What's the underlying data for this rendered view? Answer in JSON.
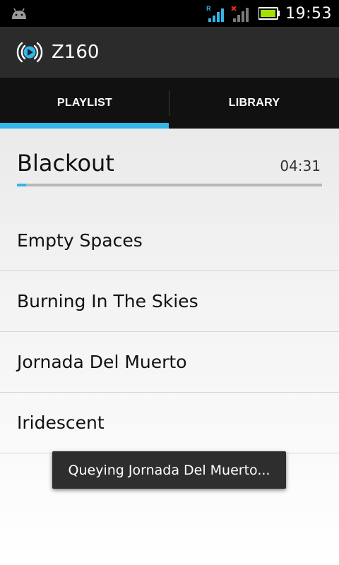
{
  "status_bar": {
    "time": "19:53",
    "signal_badge": "R",
    "icons": [
      "android-debug-icon",
      "signal-roaming-icon",
      "signal-no-data-icon",
      "battery-icon"
    ],
    "battery_color": "#a4e000"
  },
  "action_bar": {
    "title": "Z160",
    "icon": "broadcast-play-icon"
  },
  "tabs": [
    {
      "label": "PLAYLIST",
      "active": true
    },
    {
      "label": "LIBRARY",
      "active": false
    }
  ],
  "now_playing": {
    "title": "Blackout",
    "duration": "04:31",
    "progress_fraction": 0.03
  },
  "playlist": [
    {
      "title": "Empty Spaces"
    },
    {
      "title": "Burning In The Skies"
    },
    {
      "title": "Jornada Del Muerto"
    },
    {
      "title": "Iridescent"
    }
  ],
  "toast": {
    "message": "Queying Jornada Del Muerto..."
  },
  "colors": {
    "accent": "#33b5e5",
    "action_bar": "#2b2b2b",
    "tab_bar": "#111111"
  }
}
